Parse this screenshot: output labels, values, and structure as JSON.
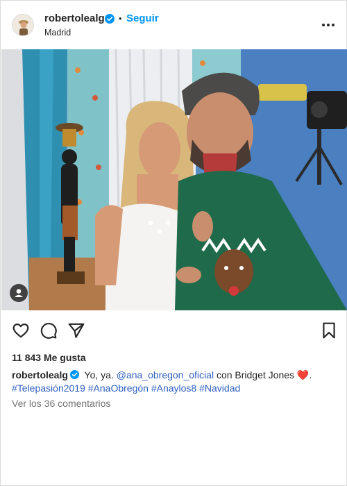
{
  "post": {
    "username": "robertolealg",
    "follow_label": "Seguir",
    "separator": "•",
    "location": "Madrid",
    "likes_count": "11 843",
    "likes_label": "Me gusta",
    "caption": {
      "username": "robertolealg",
      "text_before": " Yo, ya. ",
      "mention": "@ana_obregon_oficial",
      "text_after": " con Bridget Jones ",
      "emoji": "❤️",
      "period": ".",
      "hashtags": [
        "#Telepasión2019",
        "#AnaObregón",
        "#Anaylos8",
        "#Navidad"
      ]
    },
    "comments_link": "Ver los 36 comentarios"
  },
  "icons": {
    "verified": "verified-badge-icon",
    "more": "more-options-icon",
    "like": "heart-icon",
    "comment": "comment-icon",
    "share": "paper-plane-icon",
    "save": "bookmark-icon",
    "tag": "user-tag-icon"
  },
  "colors": {
    "accent": "#0095f6",
    "link": "#2d5fbf",
    "muted": "#737373",
    "text": "#262626"
  }
}
